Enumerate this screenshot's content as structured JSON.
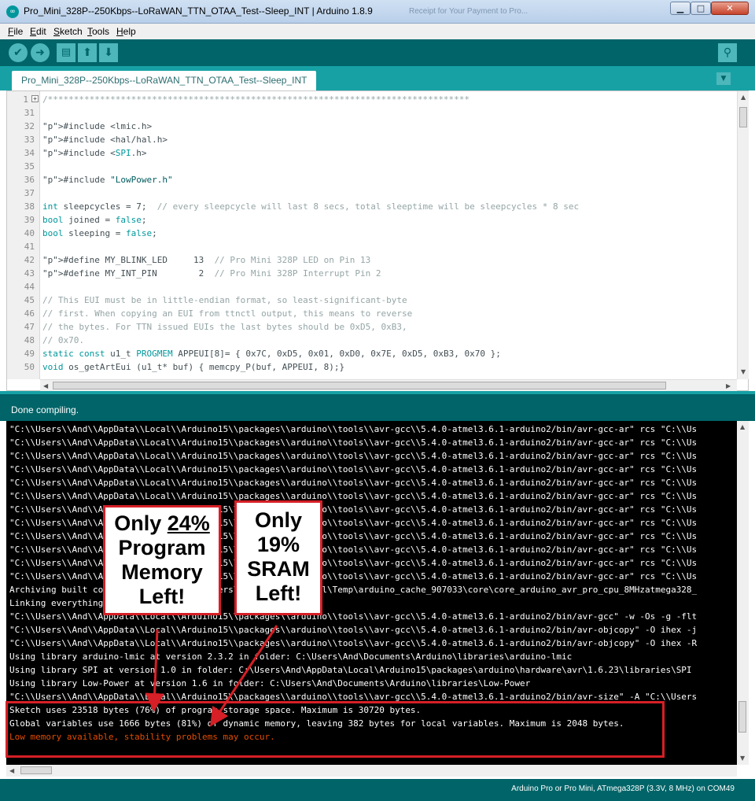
{
  "window": {
    "title": "Pro_Mini_328P--250Kbps--LoRaWAN_TTN_OTAA_Test--Sleep_INT | Arduino 1.8.9",
    "ghost_title": "Receipt for Your Payment to Pro..."
  },
  "menu": [
    "File",
    "Edit",
    "Sketch",
    "Tools",
    "Help"
  ],
  "tab": {
    "label": "Pro_Mini_328P--250Kbps--LoRaWAN_TTN_OTAA_Test--Sleep_INT"
  },
  "icons": {
    "verify": "checkmark-icon",
    "upload": "right-arrow-icon",
    "new": "new-file-icon",
    "open": "up-arrow-icon",
    "save": "down-arrow-icon",
    "serial": "magnifier-icon"
  },
  "editor": {
    "lines": [
      {
        "n": "1",
        "t": "/*********************************************************************************"
      },
      {
        "n": "31",
        "t": ""
      },
      {
        "n": "32",
        "t": "#include <lmic.h>"
      },
      {
        "n": "33",
        "t": "#include <hal/hal.h>"
      },
      {
        "n": "34",
        "t": "#include <SPI.h>"
      },
      {
        "n": "35",
        "t": ""
      },
      {
        "n": "36",
        "t": "#include \"LowPower.h\""
      },
      {
        "n": "37",
        "t": ""
      },
      {
        "n": "38",
        "t": "int sleepcycles = 7;  // every sleepcycle will last 8 secs, total sleeptime will be sleepcycles * 8 sec"
      },
      {
        "n": "39",
        "t": "bool joined = false;"
      },
      {
        "n": "40",
        "t": "bool sleeping = false;"
      },
      {
        "n": "41",
        "t": ""
      },
      {
        "n": "42",
        "t": "#define MY_BLINK_LED     13  // Pro Mini 328P LED on Pin 13"
      },
      {
        "n": "43",
        "t": "#define MY_INT_PIN        2  // Pro Mini 328P Interrupt Pin 2"
      },
      {
        "n": "44",
        "t": ""
      },
      {
        "n": "45",
        "t": "// This EUI must be in little-endian format, so least-significant-byte"
      },
      {
        "n": "46",
        "t": "// first. When copying an EUI from ttnctl output, this means to reverse"
      },
      {
        "n": "47",
        "t": "// the bytes. For TTN issued EUIs the last bytes should be 0xD5, 0xB3,"
      },
      {
        "n": "48",
        "t": "// 0x70."
      },
      {
        "n": "49",
        "t": "static const u1_t PROGMEM APPEUI[8]= { 0x7C, 0xD5, 0x01, 0xD0, 0x7E, 0xD5, 0xB3, 0x70 };"
      },
      {
        "n": "50",
        "t": "void os_getArtEui (u1_t* buf) { memcpy_P(buf, APPEUI, 8);}"
      }
    ]
  },
  "status": {
    "message": "Done compiling."
  },
  "console": {
    "lines": [
      "\"C:\\\\Users\\\\And\\\\AppData\\\\Local\\\\Arduino15\\\\packages\\\\arduino\\\\tools\\\\avr-gcc\\\\5.4.0-atmel3.6.1-arduino2/bin/avr-gcc-ar\" rcs \"C:\\\\Us",
      "\"C:\\\\Users\\\\And\\\\AppData\\\\Local\\\\Arduino15\\\\packages\\\\arduino\\\\tools\\\\avr-gcc\\\\5.4.0-atmel3.6.1-arduino2/bin/avr-gcc-ar\" rcs \"C:\\\\Us",
      "\"C:\\\\Users\\\\And\\\\AppData\\\\Local\\\\Arduino15\\\\packages\\\\arduino\\\\tools\\\\avr-gcc\\\\5.4.0-atmel3.6.1-arduino2/bin/avr-gcc-ar\" rcs \"C:\\\\Us",
      "\"C:\\\\Users\\\\And\\\\AppData\\\\Local\\\\Arduino15\\\\packages\\\\arduino\\\\tools\\\\avr-gcc\\\\5.4.0-atmel3.6.1-arduino2/bin/avr-gcc-ar\" rcs \"C:\\\\Us",
      "\"C:\\\\Users\\\\And\\\\AppData\\\\Local\\\\Arduino15\\\\packages\\\\arduino\\\\tools\\\\avr-gcc\\\\5.4.0-atmel3.6.1-arduino2/bin/avr-gcc-ar\" rcs \"C:\\\\Us",
      "\"C:\\\\Users\\\\And\\\\AppData\\\\Local\\\\Arduino15\\\\packages\\\\arduino\\\\tools\\\\avr-gcc\\\\5.4.0-atmel3.6.1-arduino2/bin/avr-gcc-ar\" rcs \"C:\\\\Us",
      "\"C:\\\\Users\\\\And\\\\AppData\\\\Local\\\\Arduino15\\\\packages\\\\arduino\\\\tools\\\\avr-gcc\\\\5.4.0-atmel3.6.1-arduino2/bin/avr-gcc-ar\" rcs \"C:\\\\Us",
      "\"C:\\\\Users\\\\And\\\\AppData\\\\Local\\\\Arduino15\\\\packages\\\\arduino\\\\tools\\\\avr-gcc\\\\5.4.0-atmel3.6.1-arduino2/bin/avr-gcc-ar\" rcs \"C:\\\\Us",
      "\"C:\\\\Users\\\\And\\\\AppData\\\\Local\\\\Arduino15\\\\packages\\\\arduino\\\\tools\\\\avr-gcc\\\\5.4.0-atmel3.6.1-arduino2/bin/avr-gcc-ar\" rcs \"C:\\\\Us",
      "\"C:\\\\Users\\\\And\\\\AppData\\\\Local\\\\Arduino15\\\\packages\\\\arduino\\\\tools\\\\avr-gcc\\\\5.4.0-atmel3.6.1-arduino2/bin/avr-gcc-ar\" rcs \"C:\\\\Us",
      "\"C:\\\\Users\\\\And\\\\AppData\\\\Local\\\\Arduino15\\\\packages\\\\arduino\\\\tools\\\\avr-gcc\\\\5.4.0-atmel3.6.1-arduino2/bin/avr-gcc-ar\" rcs \"C:\\\\Us",
      "\"C:\\\\Users\\\\And\\\\AppData\\\\Local\\\\Arduino15\\\\packages\\\\arduino\\\\tools\\\\avr-gcc\\\\5.4.0-atmel3.6.1-arduino2/bin/avr-gcc-ar\" rcs \"C:\\\\Us",
      "Archiving built core (caching) in: C:\\Users\\And\\AppData\\Local\\Temp\\arduino_cache_907033\\core\\core_arduino_avr_pro_cpu_8MHzatmega328_",
      "Linking everything together...",
      "\"C:\\\\Users\\\\And\\\\AppData\\\\Local\\\\Arduino15\\\\packages\\\\arduino\\\\tools\\\\avr-gcc\\\\5.4.0-atmel3.6.1-arduino2/bin/avr-gcc\" -w -Os -g -flt",
      "\"C:\\\\Users\\\\And\\\\AppData\\\\Local\\\\Arduino15\\\\packages\\\\arduino\\\\tools\\\\avr-gcc\\\\5.4.0-atmel3.6.1-arduino2/bin/avr-objcopy\" -O ihex -j",
      "\"C:\\\\Users\\\\And\\\\AppData\\\\Local\\\\Arduino15\\\\packages\\\\arduino\\\\tools\\\\avr-gcc\\\\5.4.0-atmel3.6.1-arduino2/bin/avr-objcopy\" -O ihex -R",
      "Using library arduino-lmic at version 2.3.2 in folder: C:\\Users\\And\\Documents\\Arduino\\libraries\\arduino-lmic",
      "Using library SPI at version 1.0 in folder: C:\\Users\\And\\AppData\\Local\\Arduino15\\packages\\arduino\\hardware\\avr\\1.6.23\\libraries\\SPI",
      "Using library Low-Power at version 1.6 in folder: C:\\Users\\And\\Documents\\Arduino\\libraries\\Low-Power",
      "\"C:\\\\Users\\\\And\\\\AppData\\\\Local\\\\Arduino15\\\\packages\\\\arduino\\\\tools\\\\avr-gcc\\\\5.4.0-atmel3.6.1-arduino2/bin/avr-size\" -A \"C:\\\\Users",
      "Sketch uses 23518 bytes (76%) of program storage space. Maximum is 30720 bytes.",
      "Global variables use 1666 bytes (81%) of dynamic memory, leaving 382 bytes for local variables. Maximum is 2048 bytes."
    ],
    "warning": "Low memory available, stability problems may occur."
  },
  "footer": {
    "board": "Arduino Pro or Pro Mini, ATmega328P (3.3V, 8 MHz) on COM49"
  },
  "annotations": {
    "program": {
      "line1": "Only",
      "pct": "24%",
      "line2": "Program",
      "line3": "Memory",
      "line4": "Left!"
    },
    "sram": {
      "line1": "Only",
      "line2": "19%",
      "line3": "SRAM",
      "line4": "Left!"
    }
  },
  "colors": {
    "teal_dark": "#006468",
    "teal": "#17a1a5",
    "alert_red": "#d61f26",
    "warning_text": "#e34c00"
  }
}
